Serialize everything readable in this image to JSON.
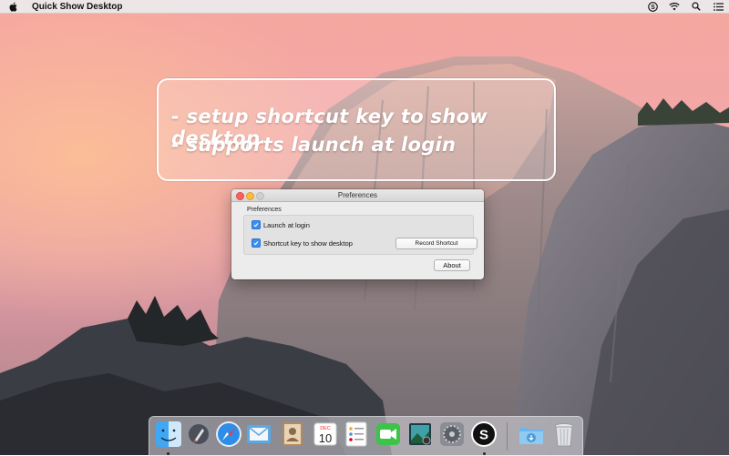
{
  "menubar": {
    "app_name": "Quick Show Desktop",
    "icons": [
      "apple-icon",
      "quick-show-desktop-icon",
      "wifi-icon",
      "search-icon",
      "notification-list-icon"
    ]
  },
  "promo": {
    "line_1": "- setup shortcut key to show desktop",
    "line_2": "- supports launch at login"
  },
  "window": {
    "title": "Preferences",
    "group_label": "Preferences",
    "launch_at_login": {
      "label": "Launch at login",
      "checked": true
    },
    "shortcut_key": {
      "label": "Shortcut key to show desktop",
      "checked": true
    },
    "record_shortcut_label": "Record Shortcut",
    "about_label": "About"
  },
  "dock": {
    "calendar_month": "DEC",
    "calendar_day": "10",
    "apps": [
      "finder-icon",
      "launchpad-icon",
      "safari-icon",
      "mail-icon",
      "contacts-icon",
      "calendar-icon",
      "reminders-icon",
      "facetime-icon",
      "photo-booth-icon",
      "system-preferences-icon",
      "quick-show-desktop-icon",
      "downloads-folder-icon",
      "trash-icon"
    ]
  },
  "colors": {
    "checkbox_blue": "#3b8ff2",
    "close_red": "#fc605c",
    "minimize_yellow": "#fdbc40"
  }
}
